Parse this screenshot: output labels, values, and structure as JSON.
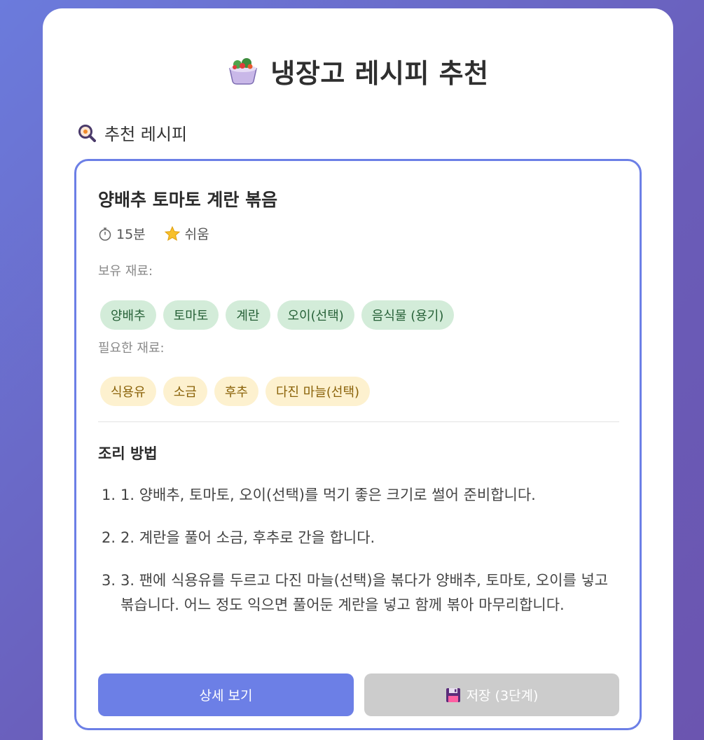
{
  "app": {
    "title": "냉장고 레시피 추천",
    "title_icon": "salad-icon"
  },
  "section": {
    "title": "추천 레시피",
    "icon": "magnifier-icon"
  },
  "recipe": {
    "name": "양배추 토마토 계란 볶음",
    "time": "15분",
    "time_icon": "stopwatch-icon",
    "difficulty": "쉬움",
    "difficulty_icon": "star-icon",
    "have_label": "보유 재료:",
    "have": [
      "양배추",
      "토마토",
      "계란",
      "오이(선택)",
      "음식물 (용기)"
    ],
    "need_label": "필요한 재료:",
    "need": [
      "식용유",
      "소금",
      "후추",
      "다진 마늘(선택)"
    ],
    "steps_title": "조리 방법",
    "steps": [
      {
        "num": "1.",
        "text": "1. 양배추, 토마토, 오이(선택)를 먹기 좋은 크기로 썰어 준비합니다."
      },
      {
        "num": "2.",
        "text": "2. 계란을 풀어 소금, 후추로 간을 합니다."
      },
      {
        "num": "3.",
        "text": "3. 팬에 식용유를 두르고 다진 마늘(선택)을 볶다가 양배추, 토마토, 오이를 넣고 볶습니다. 어느 정도 익으면 풀어둔 계란을 넣고 함께 볶아 마무리합니다."
      }
    ]
  },
  "buttons": {
    "detail": "상세 보기",
    "save": "저장 (3단계)",
    "save_icon": "floppy-disk-icon"
  },
  "colors": {
    "accent": "#6c7fe6",
    "have_bg": "#d3ecd9",
    "have_text": "#276138",
    "need_bg": "#fdf1cf",
    "need_text": "#8a6209",
    "disabled": "#cccccc"
  }
}
